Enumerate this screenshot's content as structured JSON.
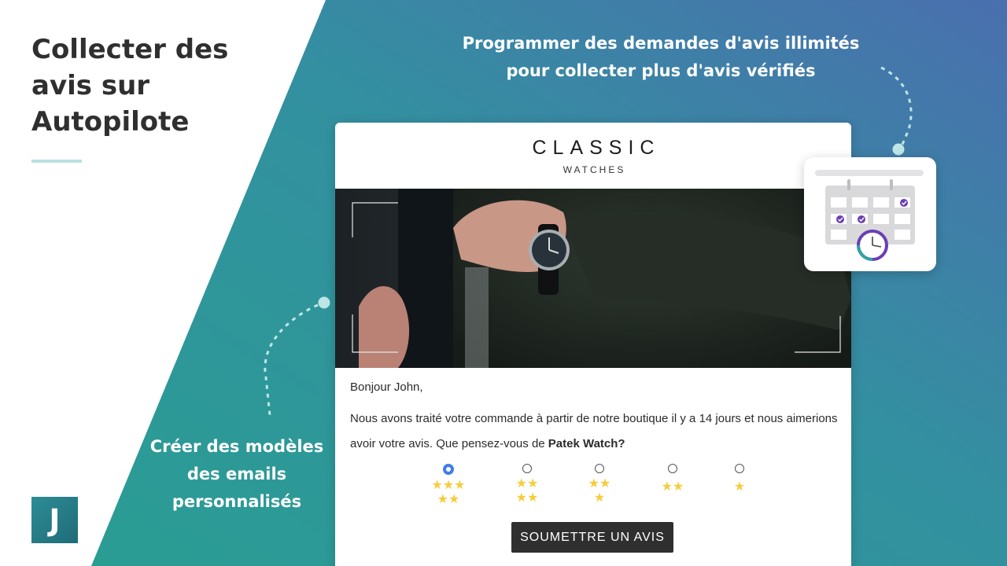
{
  "hero": {
    "title_lines": [
      "Collecter des",
      "avis sur",
      "Autopilote"
    ]
  },
  "top_caption": {
    "lines": [
      "Programmer des demandes d'avis illimités",
      "pour collecter plus d'avis vérifiés"
    ]
  },
  "left_caption": {
    "lines": [
      "Créer des modèles",
      "des emails",
      "personnalisés"
    ]
  },
  "logo": {
    "letter": "J"
  },
  "email": {
    "brand_name": "CLASSIC",
    "brand_sub": "WATCHES",
    "greeting": "Bonjour John,",
    "body_line": "Nous avons traité votre commande à partir de notre boutique il y a 14 jours et nous aimerions avoir votre avis. Que pensez-vous de",
    "product": "Patek Watch?",
    "rating_options": [
      {
        "stars_top": "★★★",
        "stars_bottom": "★★",
        "value": 5,
        "selected": true
      },
      {
        "stars_top": "★★",
        "stars_bottom": "★★",
        "value": 4,
        "selected": false
      },
      {
        "stars_top": "★★",
        "stars_bottom": "★",
        "value": 3,
        "selected": false
      },
      {
        "stars_top": "★★",
        "stars_bottom": "",
        "value": 2,
        "selected": false
      },
      {
        "stars_top": "★",
        "stars_bottom": "",
        "value": 1,
        "selected": false
      }
    ],
    "submit_label": "SOUMETTRE UN AVIS"
  },
  "colors": {
    "teal": "#2e9a9a",
    "teal_dark": "#2a8a92",
    "blue_top_right": "#4a72ad",
    "star": "#f5cd3c",
    "radio_selected": "#3f7ee6",
    "button": "#2f2f2f",
    "accent_light": "#b9e0e2",
    "calendar_check": "#6a3fb3"
  },
  "icons": [
    "calendar-icon",
    "clock-icon",
    "check-icon",
    "radio-icon",
    "star-icon"
  ]
}
